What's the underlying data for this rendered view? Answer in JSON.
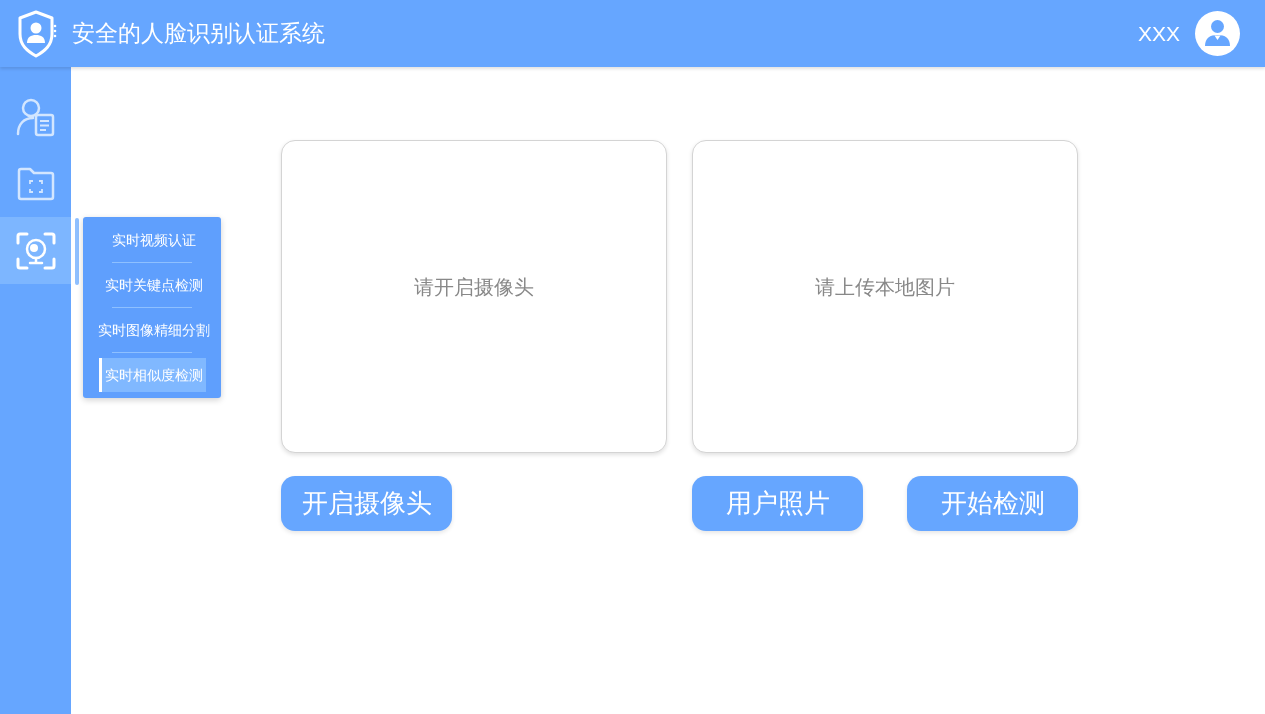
{
  "header": {
    "title": "安全的人脸识别认证系统",
    "user_name": "XXX"
  },
  "sidebar": {
    "items": [
      {
        "kind": "profile",
        "selected": false
      },
      {
        "kind": "folder",
        "selected": false
      },
      {
        "kind": "camera",
        "selected": true
      }
    ]
  },
  "submenu": {
    "items": [
      {
        "label": "实时视频认证",
        "selected": false
      },
      {
        "label": "实时关键点检测",
        "selected": false
      },
      {
        "label": "实时图像精细分割",
        "selected": false
      },
      {
        "label": "实时相似度检测",
        "selected": true
      }
    ]
  },
  "panels": [
    {
      "message": "请开启摄像头",
      "buttons": [
        {
          "label": "开启摄像头"
        }
      ]
    },
    {
      "message": "请上传本地图片",
      "buttons": [
        {
          "label": "用户照片"
        },
        {
          "label": "开始检测"
        }
      ]
    }
  ]
}
